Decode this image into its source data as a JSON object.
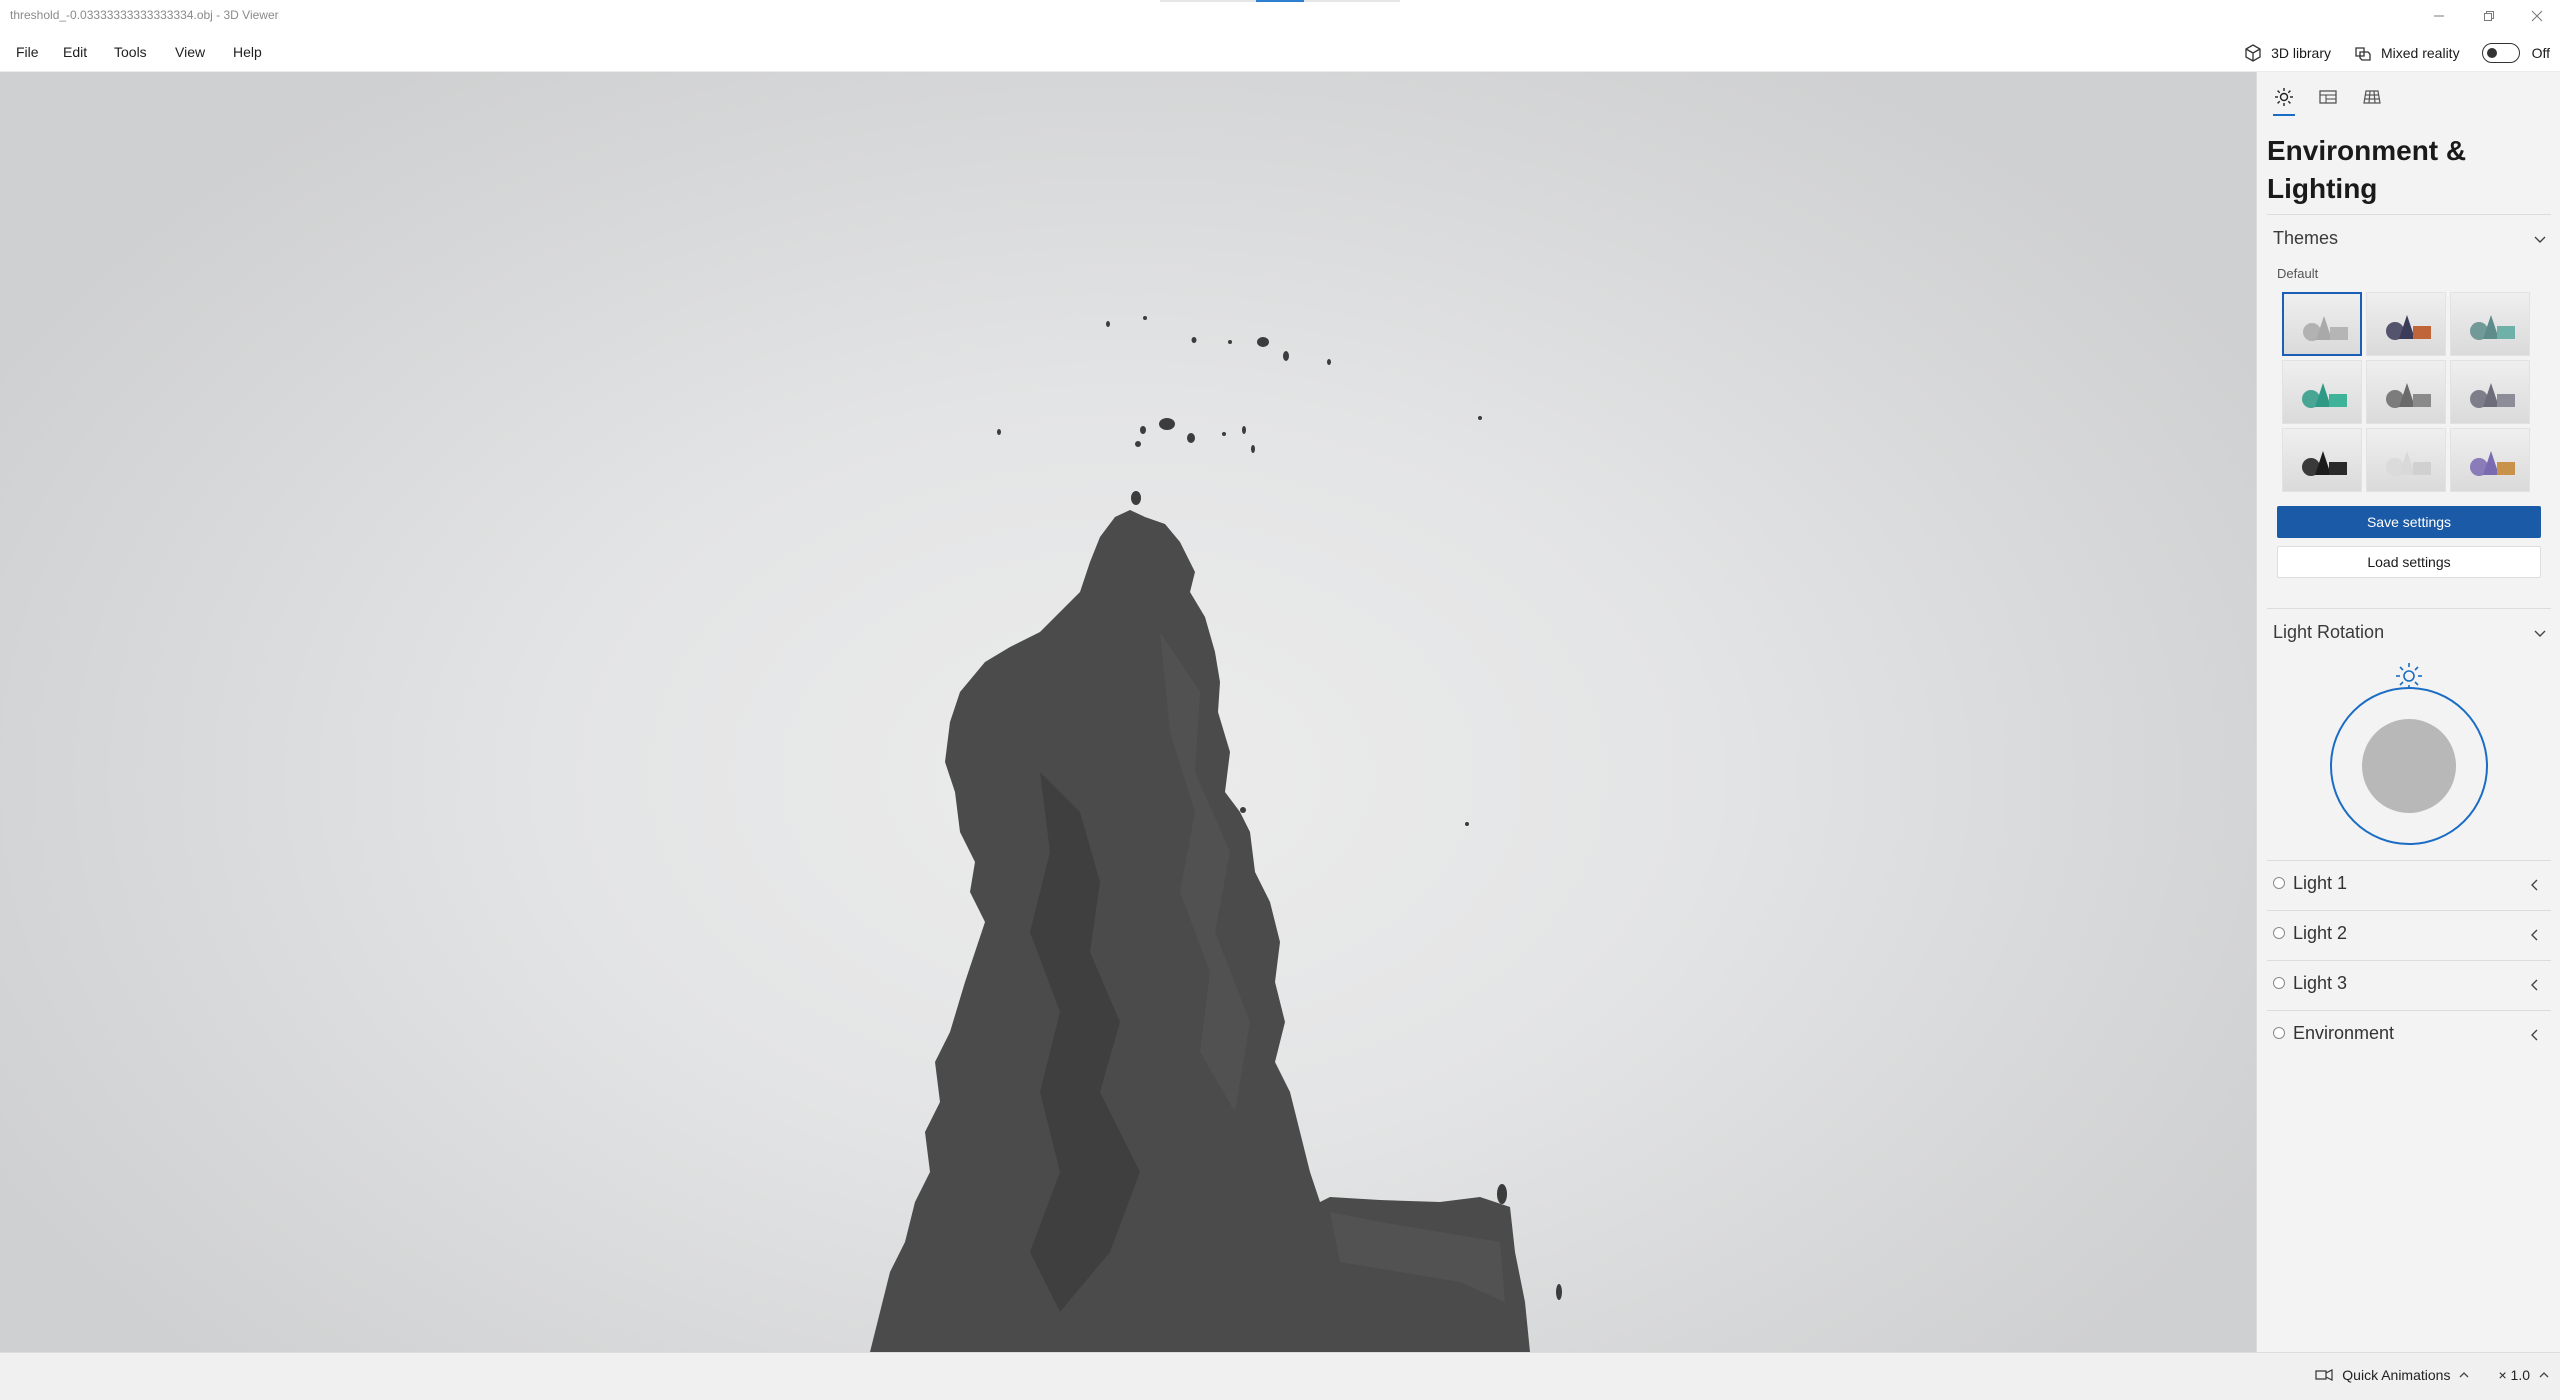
{
  "window": {
    "title": "threshold_-0.03333333333333334.obj - 3D Viewer",
    "loading_progress": 0.5
  },
  "menu": {
    "items": [
      "File",
      "Edit",
      "Tools",
      "View",
      "Help"
    ]
  },
  "toolbar": {
    "library_label": "3D library",
    "mixed_reality_label": "Mixed reality",
    "mixed_reality_state": "Off"
  },
  "panel": {
    "title": "Environment & Lighting",
    "themes": {
      "header": "Themes",
      "group_label": "Default",
      "selected_index": 0,
      "swatches": [
        {
          "shape": "#a9a9a9",
          "box": "#b5b5b5"
        },
        {
          "shape": "#3b3b5a",
          "box": "#c0643a"
        },
        {
          "shape": "#5d8c8a",
          "box": "#6fb0a8"
        },
        {
          "shape": "#2e9a86",
          "box": "#3fb39a"
        },
        {
          "shape": "#6a6a6a",
          "box": "#8a8a8a"
        },
        {
          "shape": "#6c6c7a",
          "box": "#8d8d9a"
        },
        {
          "shape": "#1c1c1c",
          "box": "#2a2a2a"
        },
        {
          "shape": "#d9d9d9",
          "box": "#d0d0d0"
        },
        {
          "shape": "#7a6ab0",
          "box": "#c9924a"
        }
      ]
    },
    "save_label": "Save settings",
    "load_label": "Load settings",
    "light_rotation": {
      "header": "Light Rotation"
    },
    "lights": [
      "Light 1",
      "Light 2",
      "Light 3",
      "Environment"
    ]
  },
  "status": {
    "animations_label": "Quick Animations",
    "speed_label": "× 1.0"
  },
  "colors": {
    "accent": "#1a5aa6",
    "model": "#4a4a4a",
    "model_shadow": "#3a3a3a"
  }
}
